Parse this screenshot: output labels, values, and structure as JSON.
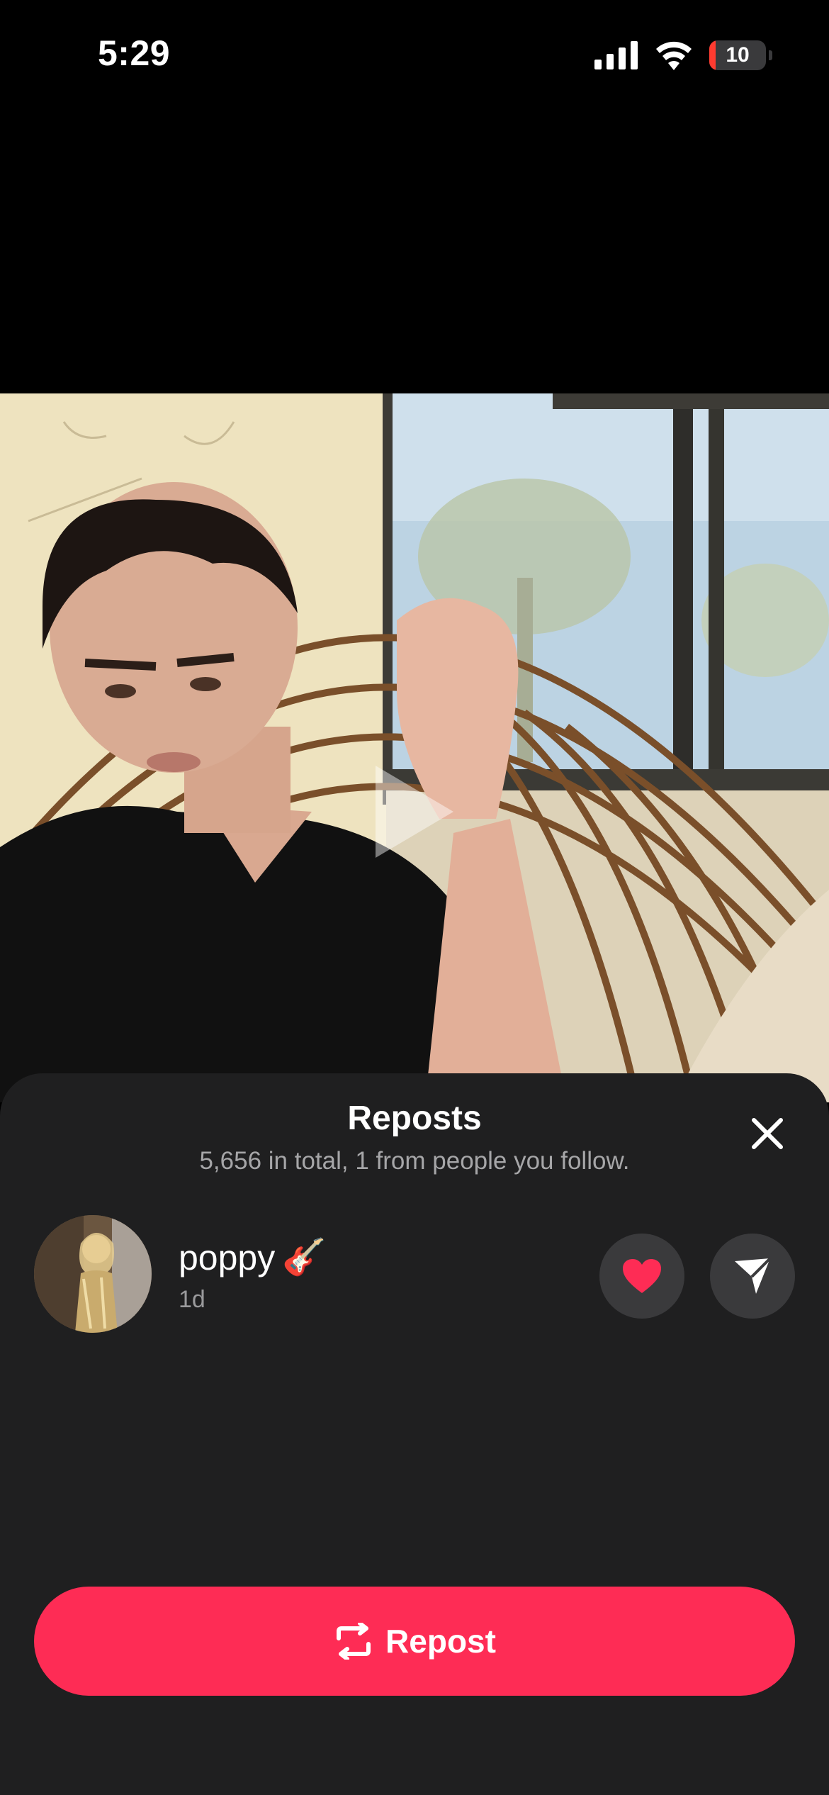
{
  "status_bar": {
    "time": "5:29",
    "battery": "10",
    "icons": [
      "signal-icon",
      "wifi-icon",
      "battery-icon"
    ]
  },
  "video": {
    "icons": [
      "play-icon"
    ]
  },
  "sheet": {
    "title": "Reposts",
    "subtitle": "5,656 in total, 1 from people you follow.",
    "close_icon": "close-icon",
    "users": [
      {
        "name": "poppy",
        "emoji": "🎸",
        "time": "1d",
        "actions": [
          "heart-icon",
          "send-icon"
        ]
      }
    ],
    "repost_label": "Repost",
    "repost_icon": "repost-icon"
  },
  "colors": {
    "accent": "#fe2c55",
    "sheet_bg": "#1f1f20",
    "button_bg": "#3a3a3c",
    "heart": "#fe2c55"
  }
}
